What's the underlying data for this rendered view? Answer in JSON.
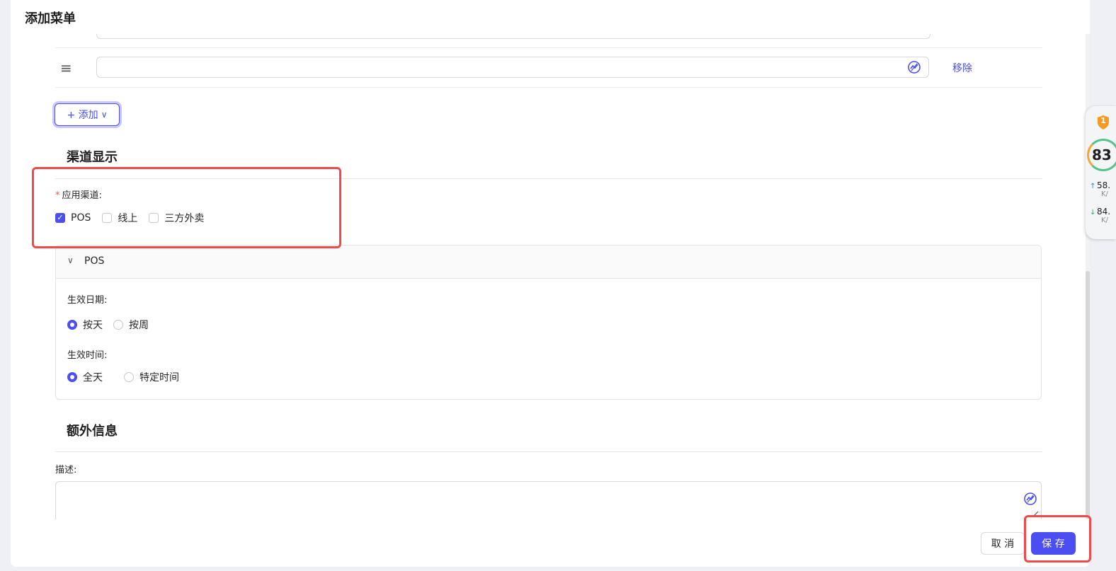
{
  "dialog": {
    "title": "添加菜单"
  },
  "menu_row": {
    "remove_label": "移除",
    "drag_icon": "≡"
  },
  "add_button": {
    "label": "+ 添加",
    "chevron": "∨"
  },
  "channel_section": {
    "title": "渠道显示",
    "required_mark": "*",
    "field_label": "应用渠道:",
    "options": [
      {
        "label": "POS",
        "checked": true
      },
      {
        "label": "线上",
        "checked": false
      },
      {
        "label": "三方外卖",
        "checked": false
      }
    ]
  },
  "pos_panel": {
    "header": "POS",
    "chevron": "∨",
    "date_label": "生效日期:",
    "date_options": [
      {
        "label": "按天",
        "selected": true
      },
      {
        "label": "按周",
        "selected": false
      }
    ],
    "time_label": "生效时间:",
    "time_options": [
      {
        "label": "全天",
        "selected": true
      },
      {
        "label": "特定时间",
        "selected": false
      }
    ]
  },
  "extra_section": {
    "title": "额外信息",
    "desc_label": "描述:"
  },
  "footer": {
    "cancel_label": "取 消",
    "save_label": "保 存"
  },
  "side_widget": {
    "badge": "1",
    "score": "83",
    "upload": {
      "arrow": "↑",
      "value": "58.",
      "unit": "K/"
    },
    "download": {
      "arrow": "↓",
      "value": "84.",
      "unit": "K/"
    }
  },
  "colors": {
    "primary": "#4b4ef0",
    "highlight": "#ef4a4a",
    "required": "#ff4d4f"
  }
}
